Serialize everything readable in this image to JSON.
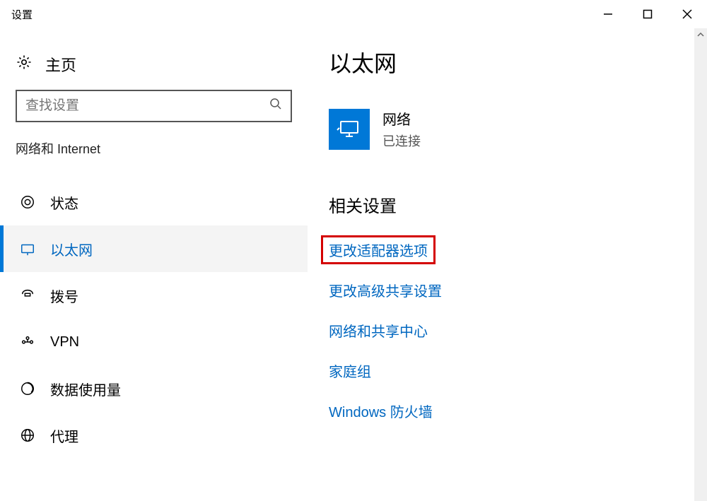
{
  "window": {
    "title": "设置"
  },
  "sidebar": {
    "home_label": "主页",
    "search_placeholder": "查找设置",
    "section_label": "网络和 Internet",
    "items": [
      {
        "label": "状态",
        "icon": "status-icon"
      },
      {
        "label": "以太网",
        "icon": "ethernet-icon"
      },
      {
        "label": "拨号",
        "icon": "dialup-icon"
      },
      {
        "label": "VPN",
        "icon": "vpn-icon"
      },
      {
        "label": "数据使用量",
        "icon": "datausage-icon"
      },
      {
        "label": "代理",
        "icon": "proxy-icon"
      }
    ]
  },
  "content": {
    "title": "以太网",
    "network": {
      "name": "网络",
      "status": "已连接"
    },
    "related_title": "相关设置",
    "links": [
      "更改适配器选项",
      "更改高级共享设置",
      "网络和共享中心",
      "家庭组",
      "Windows 防火墙"
    ]
  }
}
